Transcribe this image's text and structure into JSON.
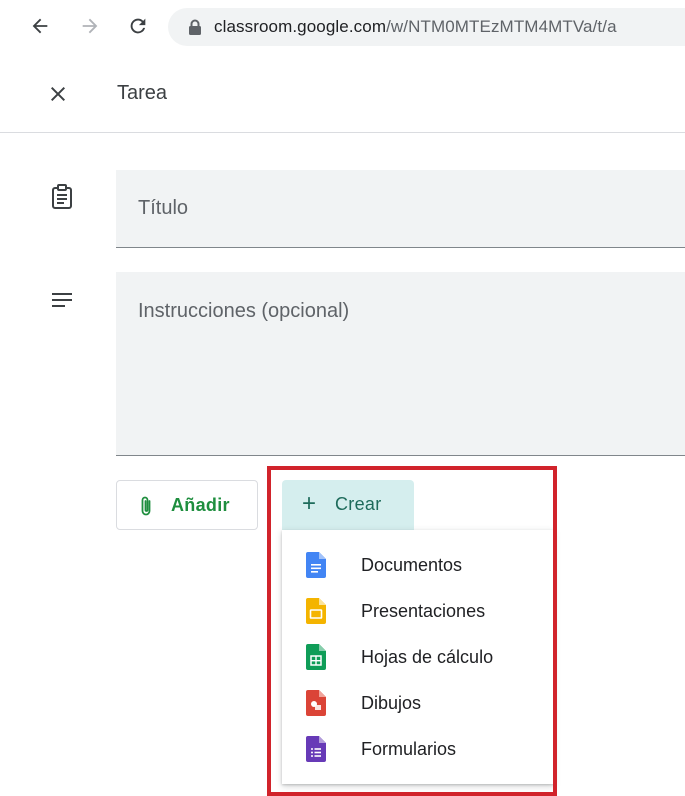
{
  "browser": {
    "url_host": "classroom.google.com",
    "url_path": "/w/NTM0MTEzMTM4MTVa/t/a"
  },
  "header": {
    "title": "Tarea"
  },
  "form": {
    "title_placeholder": "Título",
    "instructions_placeholder": "Instrucciones (opcional)"
  },
  "actions": {
    "add_label": "Añadir",
    "create_label": "Crear"
  },
  "create_menu": {
    "items": [
      {
        "label": "Documentos",
        "icon": "google-docs-icon",
        "color": "#4285f4"
      },
      {
        "label": "Presentaciones",
        "icon": "google-slides-icon",
        "color": "#f4b400"
      },
      {
        "label": "Hojas de cálculo",
        "icon": "google-sheets-icon",
        "color": "#0f9d58"
      },
      {
        "label": "Dibujos",
        "icon": "google-drawings-icon",
        "color": "#db4437"
      },
      {
        "label": "Formularios",
        "icon": "google-forms-icon",
        "color": "#673ab7"
      }
    ]
  },
  "colors": {
    "highlight_border": "#d1232b",
    "create_bg": "#d5eeee",
    "add_text": "#1e8e3e"
  }
}
